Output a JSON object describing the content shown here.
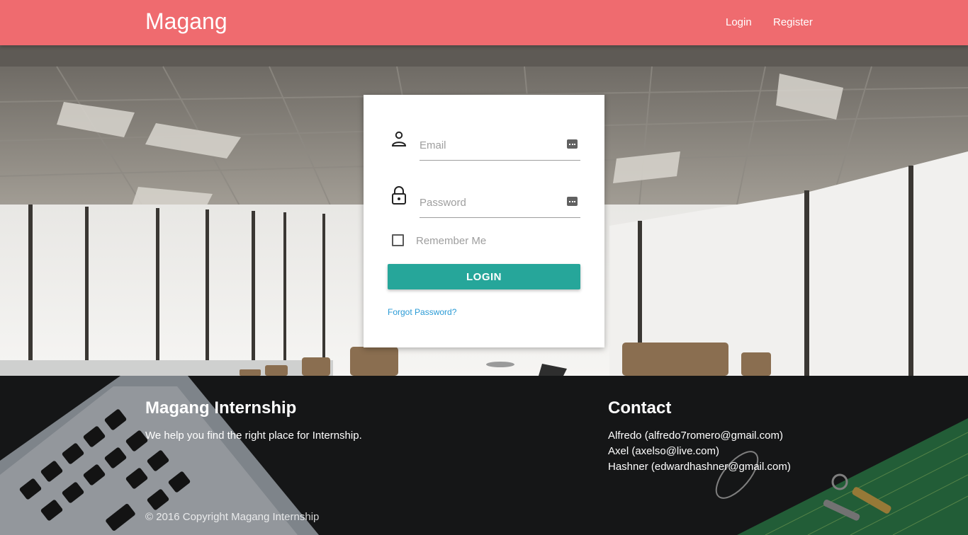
{
  "nav": {
    "brand": "Magang",
    "login": "Login",
    "register": "Register",
    "bg_color": "#ef6b6f"
  },
  "login_form": {
    "email_placeholder": "Email",
    "password_placeholder": "Password",
    "remember_label": "Remember Me",
    "remember_checked": false,
    "submit_label": "LOGIN",
    "forgot_label": "Forgot Password?",
    "button_color": "#26a69a",
    "link_color": "#2b9bd6",
    "icons": {
      "email": "person-icon",
      "password": "lock-icon",
      "autofill": "key-icon"
    }
  },
  "footer": {
    "about_title": "Magang Internship",
    "about_text": "We help you find the right place for Internship.",
    "contact_title": "Contact",
    "contacts": [
      "Alfredo (alfredo7romero@gmail.com)",
      "Axel (axelso@live.com)",
      "Hashner (edwardhashner@gmail.com)"
    ],
    "copyright": "© 2016 Copyright Magang Internship"
  }
}
